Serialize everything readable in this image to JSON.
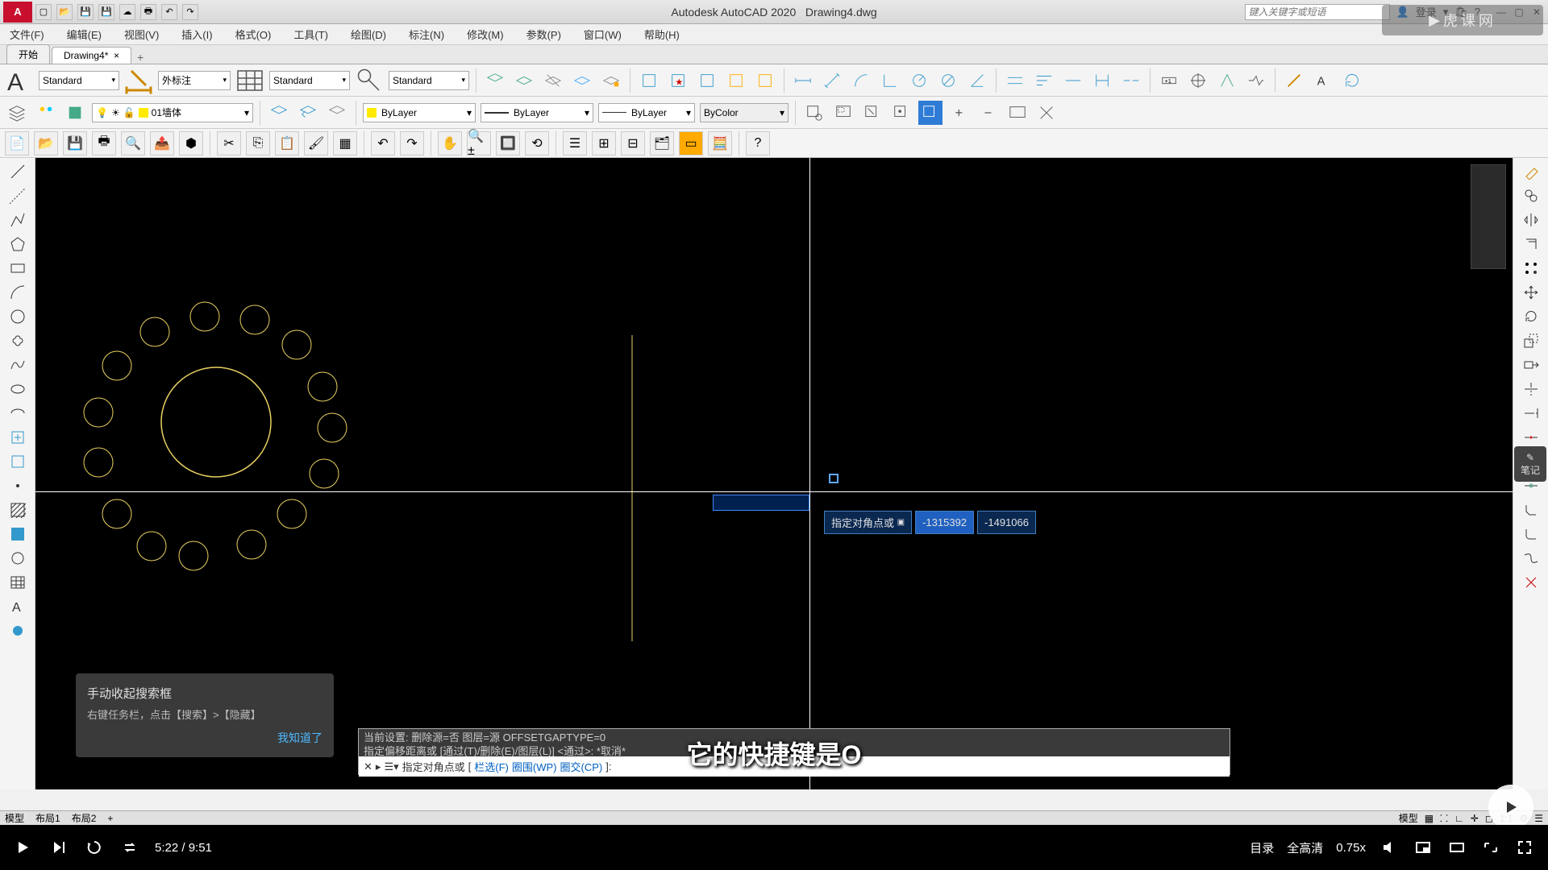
{
  "app": {
    "name": "Autodesk AutoCAD 2020",
    "file": "Drawing4.dwg",
    "logo": "A"
  },
  "search": {
    "placeholder": "键入关键字或短语"
  },
  "account": {
    "login": "登录"
  },
  "menu": {
    "file": "文件(F)",
    "edit": "编辑(E)",
    "view": "视图(V)",
    "insert": "插入(I)",
    "format": "格式(O)",
    "tools": "工具(T)",
    "draw": "绘图(D)",
    "dimension": "标注(N)",
    "modify": "修改(M)",
    "param": "参数(P)",
    "window": "窗口(W)",
    "help": "帮助(H)"
  },
  "tabs": {
    "start": "开始",
    "current": "Drawing4*"
  },
  "styles": {
    "text": "Standard",
    "dim": "外标注",
    "table": "Standard",
    "mleader": "Standard"
  },
  "layer": {
    "current": "01墙体",
    "color": "#ffea00"
  },
  "props": {
    "color": "ByLayer",
    "lw": "ByLayer",
    "lt": "ByLayer",
    "plot": "ByColor"
  },
  "dynamic_input": {
    "prompt": "指定对角点或",
    "x": "-1315392",
    "y": "-1491066"
  },
  "command": {
    "line1": "当前设置: 删除源=否  图层=源  OFFSETGAPTYPE=0",
    "line2": "指定偏移距离或 [通过(T)/删除(E)/图层(L)] <通过>: *取消*",
    "prompt_prefix": "指定对角点或",
    "opt1": "栏选(F)",
    "opt2": "圈围(WP)",
    "opt3": "圈交(CP)"
  },
  "tooltip": {
    "title": "手动收起搜索框",
    "sub": "右键任务栏，点击【搜索】>【隐藏】",
    "ok": "我知道了"
  },
  "bottom": {
    "model": "模型",
    "layout1": "布局1",
    "layout2": "布局2",
    "model_r": "模型",
    "scale": "1:1"
  },
  "subtitle": "它的快捷键是O",
  "video": {
    "time": "5:22 / 9:51",
    "catalog": "目录",
    "quality": "全高清",
    "speed": "0.75x"
  },
  "watermark": "虎课网",
  "note_badge": "笔记"
}
